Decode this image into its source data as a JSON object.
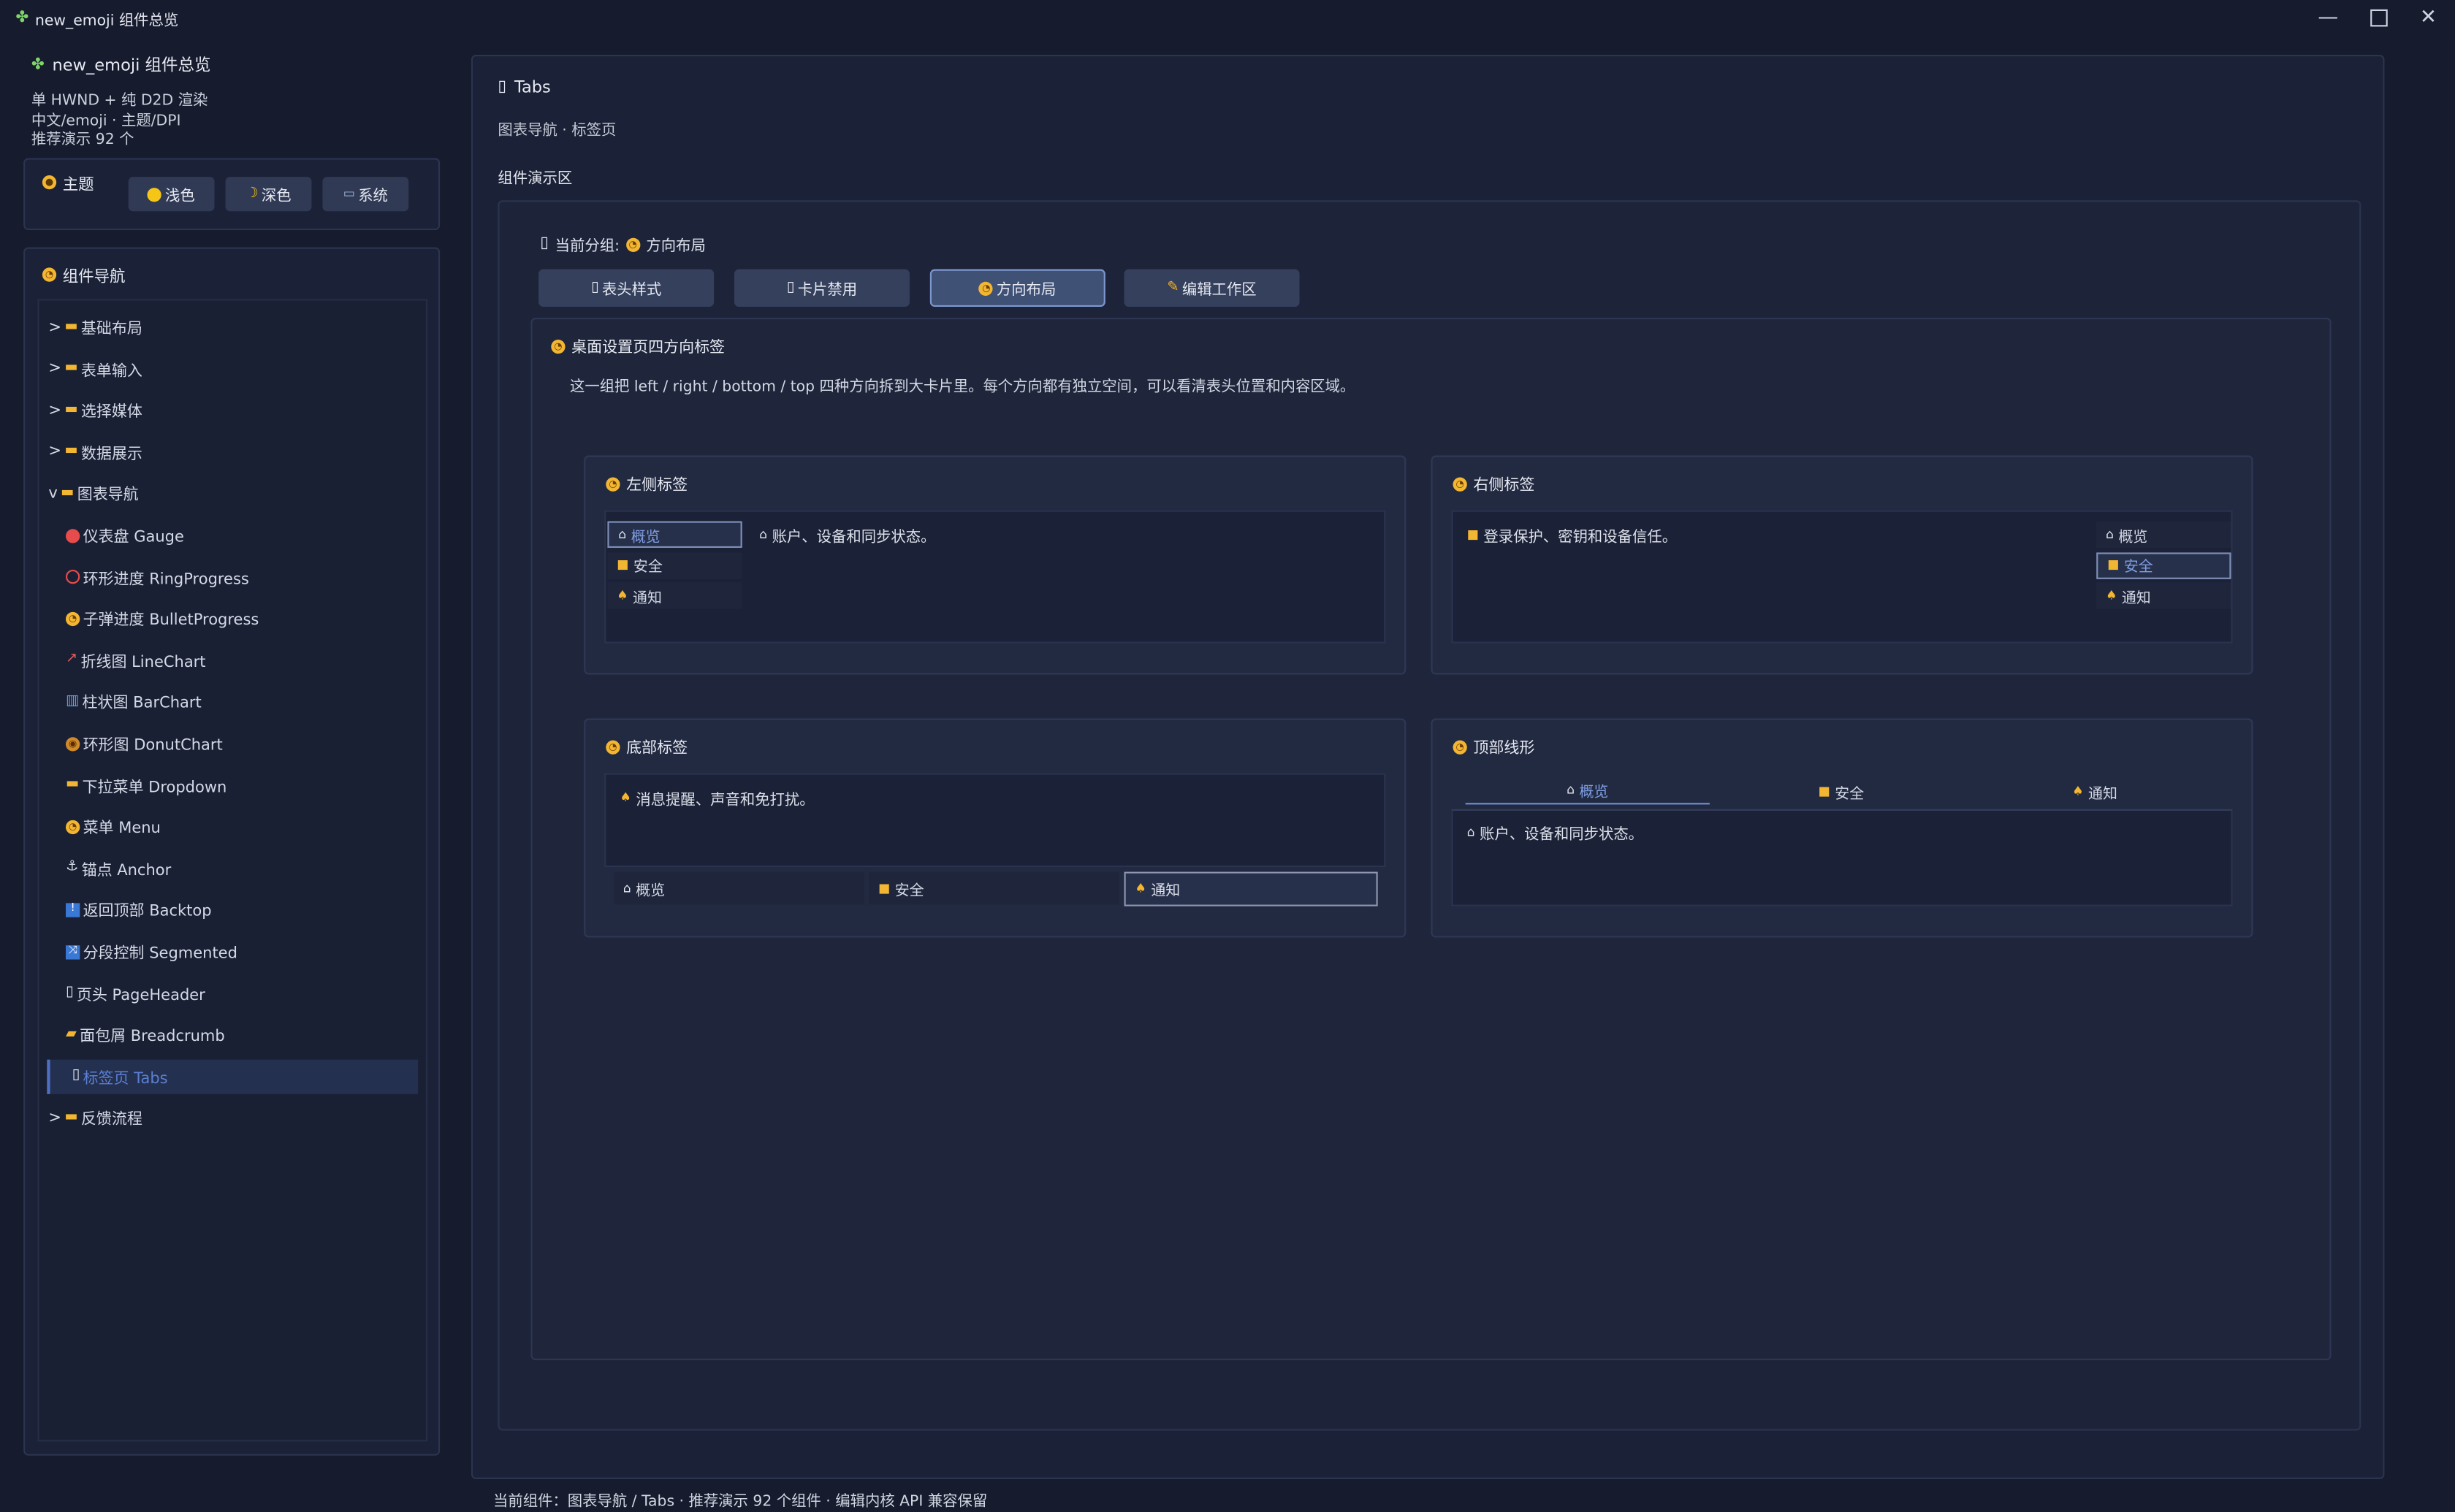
{
  "window": {
    "title": "new_emoji 组件总览",
    "controls": [
      "minimize",
      "maximize",
      "close"
    ]
  },
  "sidebar": {
    "app_title": "new_emoji 组件总览",
    "meta_line1": "单 HWND + 纯 D2D 渲染",
    "meta_line2": "中文/emoji · 主题/DPI",
    "meta_line3": "推荐演示 92 个",
    "theme": {
      "label": "主题",
      "buttons": [
        "浅色",
        "深色",
        "系统"
      ]
    },
    "nav": {
      "label": "组件导航",
      "items": [
        {
          "prefix": ">",
          "label": "基础布局",
          "level": 0
        },
        {
          "prefix": ">",
          "label": "表单输入",
          "level": 0
        },
        {
          "prefix": ">",
          "label": "选择媒体",
          "level": 0
        },
        {
          "prefix": ">",
          "label": "数据展示",
          "level": 0
        },
        {
          "prefix": "v",
          "label": "图表导航",
          "level": 0
        },
        {
          "prefix": "",
          "label": "仪表盘 Gauge",
          "level": 1
        },
        {
          "prefix": "",
          "label": "环形进度 RingProgress",
          "level": 1
        },
        {
          "prefix": "",
          "label": "子弹进度 BulletProgress",
          "level": 1
        },
        {
          "prefix": "",
          "label": "折线图 LineChart",
          "level": 1
        },
        {
          "prefix": "",
          "label": "柱状图 BarChart",
          "level": 1
        },
        {
          "prefix": "",
          "label": "环形图 DonutChart",
          "level": 1
        },
        {
          "prefix": "",
          "label": "下拉菜单 Dropdown",
          "level": 1
        },
        {
          "prefix": "",
          "label": "菜单 Menu",
          "level": 1
        },
        {
          "prefix": "",
          "label": "锚点 Anchor",
          "level": 1
        },
        {
          "prefix": "",
          "label": "返回顶部 Backtop",
          "level": 1
        },
        {
          "prefix": "",
          "label": "分段控制 Segmented",
          "level": 1
        },
        {
          "prefix": "",
          "label": "页头 PageHeader",
          "level": 1
        },
        {
          "prefix": "",
          "label": "面包屑 Breadcrumb",
          "level": 1
        },
        {
          "prefix": "",
          "label": "标签页 Tabs",
          "level": 1,
          "active": true
        },
        {
          "prefix": ">",
          "label": "反馈流程",
          "level": 0
        }
      ]
    }
  },
  "main": {
    "title": "Tabs",
    "subtitle": "图表导航 · 标签页",
    "demo_label": "组件演示区",
    "group_prefix": "当前分组:",
    "group_value": "方向布局",
    "group_buttons": [
      "表头样式",
      "卡片禁用",
      "方向布局",
      "编辑工作区"
    ],
    "selected_group": "方向布局",
    "card": {
      "title": "桌面设置页四方向标签",
      "desc": "这一组把 left / right / bottom / top 四种方向拆到大卡片里。每个方向都有独立空间，可以看清表头位置和内容区域。",
      "left": {
        "title": "左侧标签",
        "tabs": [
          "概览",
          "安全",
          "通知"
        ],
        "selected": "概览",
        "content": "账户、设备和同步状态。"
      },
      "right": {
        "title": "右侧标签",
        "tabs": [
          "概览",
          "安全",
          "通知"
        ],
        "selected": "安全",
        "content": "登录保护、密钥和设备信任。"
      },
      "bottom": {
        "title": "底部标签",
        "tabs": [
          "概览",
          "安全",
          "通知"
        ],
        "selected": "通知",
        "content": "消息提醒、声音和免打扰。"
      },
      "top": {
        "title": "顶部线形",
        "tabs": [
          "概览",
          "安全",
          "通知"
        ],
        "selected": "概览",
        "content": "账户、设备和同步状态。"
      }
    }
  },
  "status_bar": "当前组件：图表导航 / Tabs · 推荐演示 92 个组件 · 编辑内核 API 兼容保留",
  "colors": {
    "background": "#161b2d",
    "panel": "#1b2136",
    "accent": "#5b7fd3",
    "selected_tab_text": "#7f9ee3",
    "button": "#303a55"
  }
}
